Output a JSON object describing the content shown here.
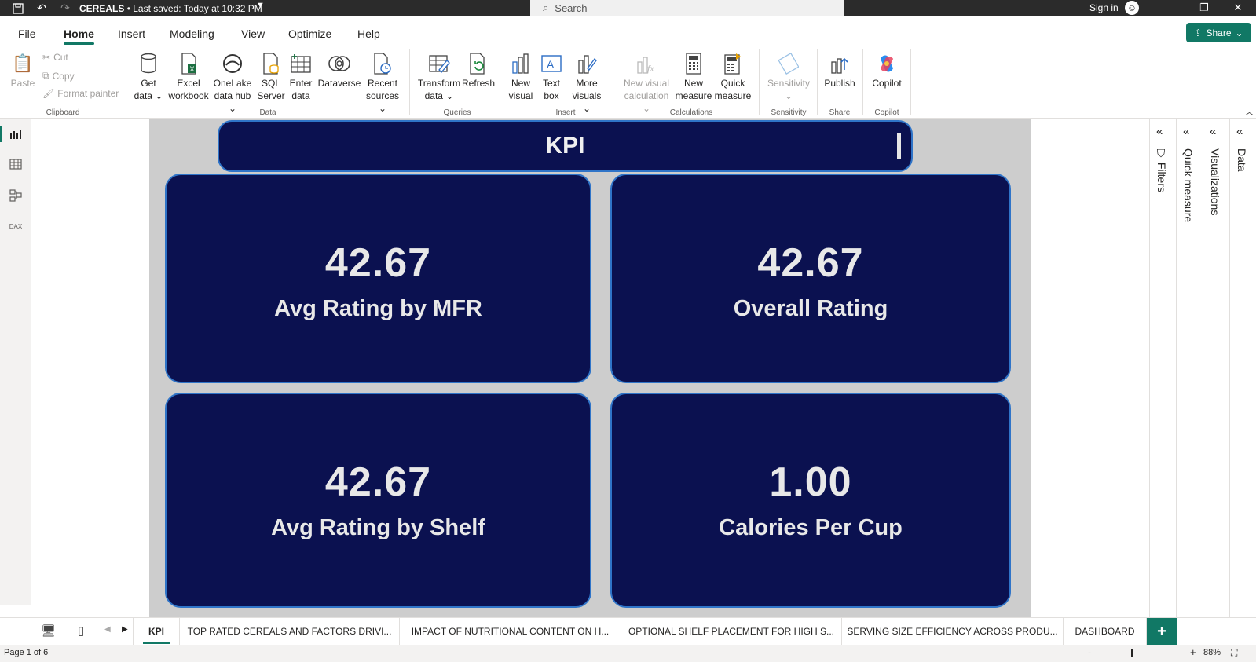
{
  "titlebar": {
    "doc_title": "CEREALS",
    "saved_status": "• Last saved: Today at 10:32 PM",
    "search_placeholder": "Search",
    "sign_in": "Sign in"
  },
  "menu": {
    "items": [
      "File",
      "Home",
      "Insert",
      "Modeling",
      "View",
      "Optimize",
      "Help"
    ],
    "active": "Home",
    "share_label": "Share"
  },
  "ribbon": {
    "clipboard": {
      "paste": "Paste",
      "cut": "Cut",
      "copy": "Copy",
      "format_painter": "Format painter",
      "group": "Clipboard"
    },
    "data": {
      "get_data": [
        "Get",
        "data"
      ],
      "excel": [
        "Excel",
        "workbook"
      ],
      "onelake": [
        "OneLake",
        "data hub"
      ],
      "sql": [
        "SQL",
        "Server"
      ],
      "enter": [
        "Enter",
        "data"
      ],
      "dataverse": [
        "Dataverse",
        ""
      ],
      "recent": [
        "Recent",
        "sources"
      ],
      "group": "Data"
    },
    "queries": {
      "transform": [
        "Transform",
        "data"
      ],
      "refresh": [
        "Refresh",
        ""
      ],
      "group": "Queries"
    },
    "insert": {
      "new_visual": [
        "New",
        "visual"
      ],
      "text_box": [
        "Text",
        "box"
      ],
      "more_visuals": [
        "More",
        "visuals"
      ],
      "group": "Insert"
    },
    "calculations": {
      "new_visual_calc": [
        "New visual",
        "calculation"
      ],
      "new_measure": [
        "New",
        "measure"
      ],
      "quick_measure": [
        "Quick",
        "measure"
      ],
      "group": "Calculations"
    },
    "sensitivity": {
      "label": "Sensitivity",
      "group": "Sensitivity"
    },
    "share": {
      "publish": "Publish",
      "group": "Share"
    },
    "copilot": {
      "label": "Copilot",
      "group": "Copilot"
    }
  },
  "report": {
    "header": "KPI",
    "cards": [
      {
        "value": "42.67",
        "label": "Avg Rating by MFR"
      },
      {
        "value": "42.67",
        "label": "Overall Rating"
      },
      {
        "value": "42.67",
        "label": "Avg Rating by Shelf"
      },
      {
        "value": "1.00",
        "label": "Calories Per Cup"
      }
    ]
  },
  "panes": {
    "filters": "Filters",
    "quick_measure": "Quick measure",
    "visualizations": "Visualizations",
    "data": "Data"
  },
  "tabs": [
    "KPI",
    "TOP RATED CEREALS AND FACTORS DRIVI...",
    "IMPACT OF NUTRITIONAL CONTENT ON H...",
    "OPTIONAL SHELF PLACEMENT FOR HIGH S...",
    "SERVING SIZE EFFICIENCY ACROSS PRODU...",
    "DASHBOARD"
  ],
  "status": {
    "page": "Page 1 of 6",
    "zoom": "88%"
  }
}
